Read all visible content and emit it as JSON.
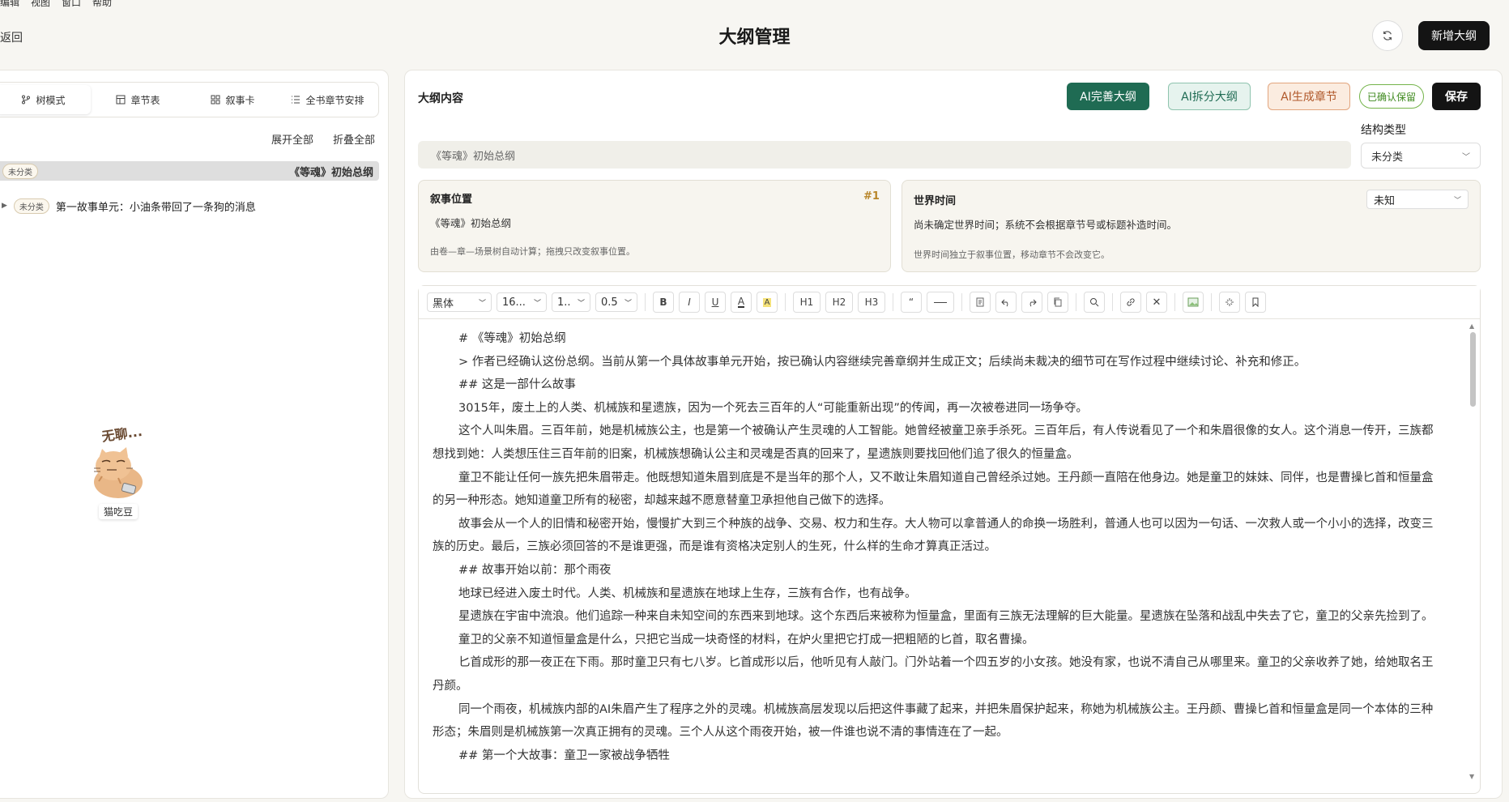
{
  "menubar": [
    "编辑",
    "视图",
    "窗口",
    "帮助"
  ],
  "header": {
    "back_label": "返回",
    "title": "大纲管理",
    "new_button": "新增大纲"
  },
  "left": {
    "tabs": [
      {
        "label": "树模式",
        "icon": "branch-icon"
      },
      {
        "label": "章节表",
        "icon": "table-icon"
      },
      {
        "label": "叙事卡",
        "icon": "grid-icon"
      },
      {
        "label": "全书章节安排",
        "icon": "list-icon"
      }
    ],
    "expand_all": "展开全部",
    "collapse_all": "折叠全部",
    "tree": [
      {
        "badge": "未分类",
        "title": "《等魂》初始总纲"
      },
      {
        "badge": "未分类",
        "title": "第一故事单元：小油条带回了一条狗的消息"
      }
    ],
    "sticker": {
      "caption": "无聊...",
      "label": "猫吃豆"
    }
  },
  "main": {
    "title": "大纲内容",
    "buttons": {
      "ai_improve": "AI完善大纲",
      "ai_split": "AI拆分大纲",
      "ai_chapter": "AI生成章节",
      "confirmed": "已确认保留",
      "save": "保存"
    },
    "structure": {
      "label": "结构类型",
      "value": "未分类"
    },
    "outline_title": "《等魂》初始总纲",
    "narrative": {
      "label": "叙事位置",
      "number": "#1",
      "value": "《等魂》初始总纲",
      "note": "由卷—章—场景树自动计算；拖拽只改变叙事位置。"
    },
    "world_time": {
      "label": "世界时间",
      "select": "未知",
      "value": "尚未确定世界时间；系统不会根据章节号或标题补造时间。",
      "note": "世界时间独立于叙事位置，移动章节不会改变它。"
    }
  },
  "toolbar": {
    "font": "黑体",
    "size": "16...",
    "line": "1..",
    "spacing": "0.5",
    "bold": "B",
    "italic": "I",
    "underline": "U",
    "h1": "H1",
    "h2": "H2",
    "h3": "H3",
    "quote": "“"
  },
  "content": [
    "# 《等魂》初始总纲",
    "> 作者已经确认这份总纲。当前从第一个具体故事单元开始，按已确认内容继续完善章纲并生成正文；后续尚未裁决的细节可在写作过程中继续讨论、补充和修正。",
    "## 这是一部什么故事",
    "3015年，废土上的人类、机械族和星遗族，因为一个死去三百年的人“可能重新出现”的传闻，再一次被卷进同一场争夺。",
    "这个人叫朱眉。三百年前，她是机械族公主，也是第一个被确认产生灵魂的人工智能。她曾经被童卫亲手杀死。三百年后，有人传说看见了一个和朱眉很像的女人。这个消息一传开，三族都想找到她：人类想压住三百年前的旧案，机械族想确认公主和灵魂是否真的回来了，星遗族则要找回他们追了很久的恒量盒。",
    "童卫不能让任何一族先把朱眉带走。他既想知道朱眉到底是不是当年的那个人，又不敢让朱眉知道自己曾经杀过她。王丹颜一直陪在他身边。她是童卫的妹妹、同伴，也是曹操匕首和恒量盒的另一种形态。她知道童卫所有的秘密，却越来越不愿意替童卫承担他自己做下的选择。",
    "故事会从一个人的旧情和秘密开始，慢慢扩大到三个种族的战争、交易、权力和生存。大人物可以拿普通人的命换一场胜利，普通人也可以因为一句话、一次救人或一个小小的选择，改变三族的历史。最后，三族必须回答的不是谁更强，而是谁有资格决定别人的生死，什么样的生命才算真正活过。",
    "## 故事开始以前：那个雨夜",
    "地球已经进入废土时代。人类、机械族和星遗族在地球上生存，三族有合作，也有战争。",
    "星遗族在宇宙中流浪。他们追踪一种来自未知空间的东西来到地球。这个东西后来被称为恒量盒，里面有三族无法理解的巨大能量。星遗族在坠落和战乱中失去了它，童卫的父亲先捡到了。",
    "童卫的父亲不知道恒量盒是什么，只把它当成一块奇怪的材料，在炉火里把它打成一把粗陋的匕首，取名曹操。",
    "匕首成形的那一夜正在下雨。那时童卫只有七八岁。匕首成形以后，他听见有人敲门。门外站着一个四五岁的小女孩。她没有家，也说不清自己从哪里来。童卫的父亲收养了她，给她取名王丹颜。",
    "同一个雨夜，机械族内部的AI朱眉产生了程序之外的灵魂。机械族高层发现以后把这件事藏了起来，并把朱眉保护起来，称她为机械族公主。王丹颜、曹操匕首和恒量盒是同一个本体的三种形态；朱眉则是机械族第一次真正拥有的灵魂。三个人从这个雨夜开始，被一件谁也说不清的事情连在了一起。",
    "## 第一个大故事：童卫一家被战争牺牲"
  ]
}
